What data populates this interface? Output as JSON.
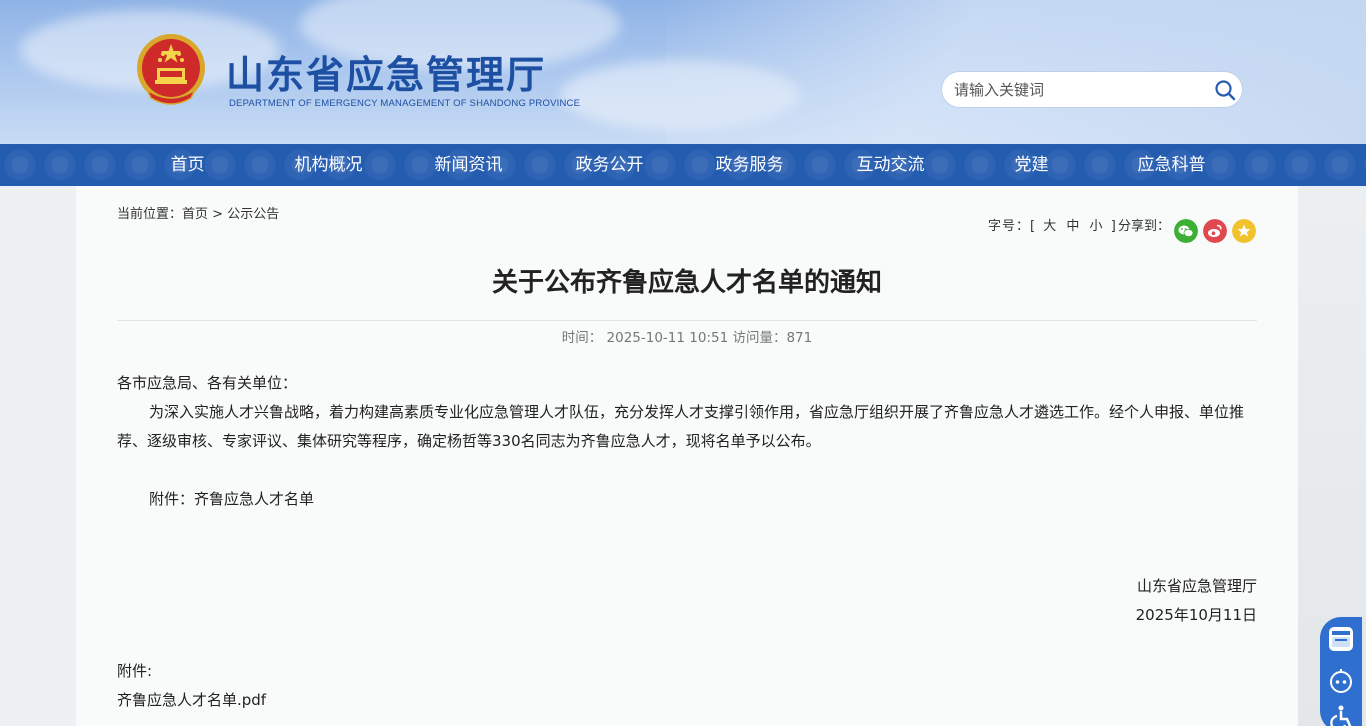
{
  "header": {
    "site_title": "山东省应急管理厅",
    "site_subtitle": "DEPARTMENT OF EMERGENCY MANAGEMENT OF SHANDONG PROVINCE",
    "search_placeholder": "请输入关键词"
  },
  "nav": {
    "items": [
      {
        "label": "首页"
      },
      {
        "label": "机构概况"
      },
      {
        "label": "新闻资讯"
      },
      {
        "label": "政务公开"
      },
      {
        "label": "政务服务"
      },
      {
        "label": "互动交流"
      },
      {
        "label": "党建"
      },
      {
        "label": "应急科普"
      }
    ]
  },
  "breadcrumb": {
    "prefix": "当前位置：",
    "home": "首页",
    "separator": ">",
    "current": "公示公告"
  },
  "tools": {
    "font_size_label": "字号：[",
    "font_large": "大",
    "font_medium": "中",
    "font_small": "小",
    "font_size_close": "]",
    "share_label": "分享到：",
    "share_icons": [
      "wechat-icon",
      "weibo-icon",
      "favorite-icon"
    ],
    "colors": {
      "wechat": "#3cb034",
      "weibo": "#e0484f",
      "favorite": "#f2c12e"
    }
  },
  "article": {
    "title": "关于公布齐鲁应急人才名单的通知",
    "meta": "时间：  2025-10-11 10:51 访问量：871",
    "salutation": "各市应急局、各有关单位：",
    "paragraph": "为深入实施人才兴鲁战略，着力构建高素质专业化应急管理人才队伍，充分发挥人才支撑引领作用，省应急厅组织开展了齐鲁应急人才遴选工作。经个人申报、单位推荐、逐级审核、专家评议、集体研究等程序，确定杨哲等330名同志为齐鲁应急人才，现将名单予以公布。",
    "attachment_note": "附件：齐鲁应急人才名单",
    "signature_org": "山东省应急管理厅",
    "signature_date": "2025年10月11日",
    "attachments_heading": "附件:",
    "attachment_file": "齐鲁应急人才名单.pdf"
  },
  "float_tools": {
    "icons": [
      "government-app-icon",
      "robot-assistant-icon",
      "accessibility-icon"
    ],
    "colors": {
      "background": "#2f6fd0"
    }
  }
}
